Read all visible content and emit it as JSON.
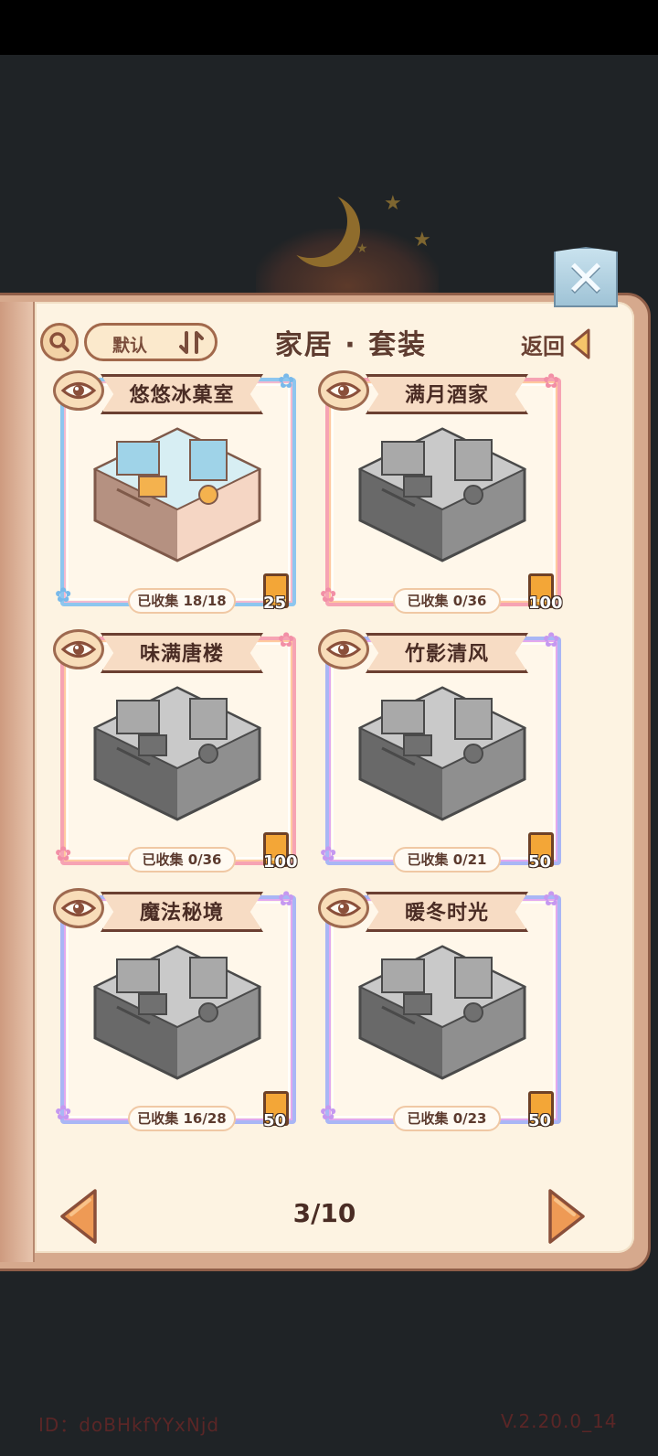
{
  "header": {
    "sort_label": "默认",
    "title": "家居 · 套装",
    "back_label": "返回"
  },
  "cards": [
    {
      "name": "悠悠冰菓室",
      "progress": "已收集 18/18",
      "reward": "25",
      "collected_fraction": 1.0,
      "theme": "blue",
      "colored": true
    },
    {
      "name": "满月酒家",
      "progress": "已收集 0/36",
      "reward": "100",
      "collected_fraction": 0.0,
      "theme": "pink",
      "colored": false
    },
    {
      "name": "味满唐楼",
      "progress": "已收集 0/36",
      "reward": "100",
      "collected_fraction": 0.0,
      "theme": "pink",
      "colored": false
    },
    {
      "name": "竹影清风",
      "progress": "已收集 0/21",
      "reward": "50",
      "collected_fraction": 0.0,
      "theme": "violet",
      "colored": false
    },
    {
      "name": "魔法秘境",
      "progress": "已收集 16/28",
      "reward": "50",
      "collected_fraction": 0.571,
      "theme": "violet",
      "colored": false
    },
    {
      "name": "暖冬时光",
      "progress": "已收集 0/23",
      "reward": "50",
      "collected_fraction": 0.0,
      "theme": "violet",
      "colored": false
    }
  ],
  "pager": {
    "indicator": "3/10"
  },
  "footer": {
    "id": "ID：doBHkfYYxNjd",
    "version": "V.2.20.0_14"
  },
  "colors": {
    "page_bg": "#fdf3e2",
    "book_edge": "#d6a98d",
    "title_text": "#5e3c30",
    "reward_book": "#f3a637",
    "close_button": "#9fc3d6"
  },
  "icons": {
    "search": "search-icon",
    "sort": "sort-icon",
    "back": "back-arrow-icon",
    "close": "close-icon",
    "eye": "eye-icon",
    "reward": "book-icon",
    "prev": "prev-page-icon",
    "next": "next-page-icon"
  }
}
